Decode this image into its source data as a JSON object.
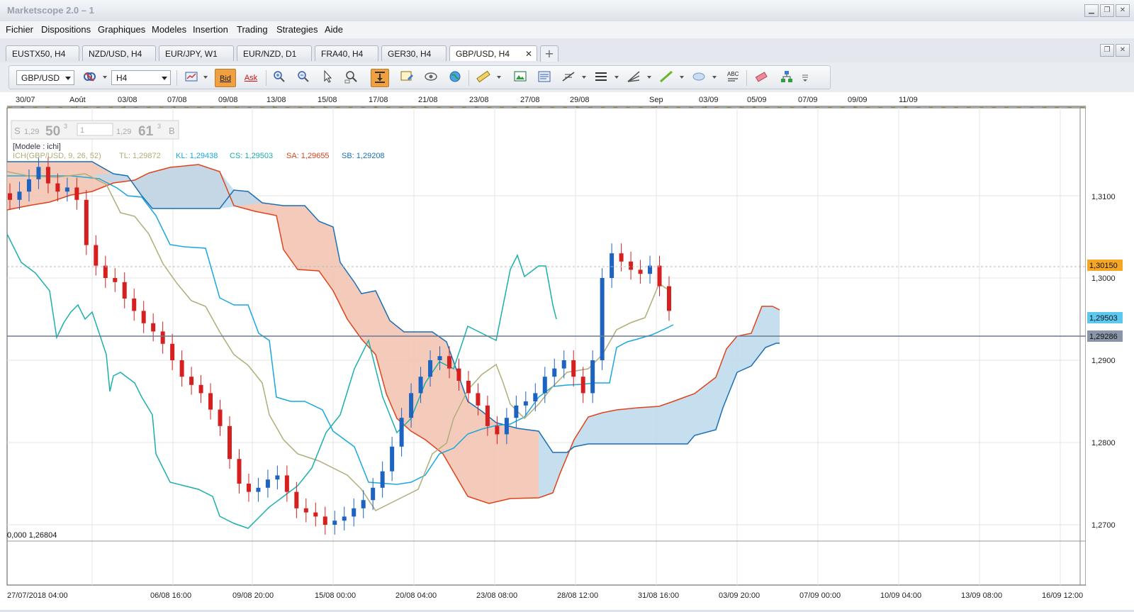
{
  "window": {
    "title": "Marketscope 2.0 – 1"
  },
  "menu": [
    "Fichier",
    "Dispositions",
    "Graphiques",
    "Modeles",
    "Insertion",
    "Trading",
    "Strategies",
    "Aide"
  ],
  "tabs": [
    {
      "label": "EUSTX50, H4"
    },
    {
      "label": "NZD/USD, H4"
    },
    {
      "label": "EUR/JPY, W1"
    },
    {
      "label": "EUR/NZD, D1"
    },
    {
      "label": "FRA40, H4"
    },
    {
      "label": "GER30, H4"
    },
    {
      "label": "GBP/USD, H4",
      "active": true
    }
  ],
  "toolbar": {
    "symbol": "GBP/USD",
    "timeframe": "H4",
    "bid_label": "Bid",
    "ask_label": "Ask",
    "icons": [
      "symbol-icon",
      "timeframe-icon",
      "chart-type-icon",
      "zoom-in-icon",
      "zoom-out-icon",
      "cursor-icon",
      "zoom-range-icon",
      "autoscroll-icon",
      "template-icon",
      "eye-icon",
      "globe-icon",
      "ruler-icon",
      "screenshot-icon",
      "properties-icon",
      "fibonacci-icon",
      "lines-icon",
      "pitchfork-icon",
      "trendline-icon",
      "ellipse-icon",
      "text-icon",
      "eraser-icon",
      "hierarchy-icon",
      "more-icon"
    ]
  },
  "dealing_box": {
    "sell_label": "S",
    "sell_prefix": "1,29",
    "sell_big": "50",
    "sell_sup": "3",
    "amount": "1",
    "buy_prefix": "1,29",
    "buy_big": "61",
    "buy_sup": "3",
    "buy_label": "B"
  },
  "chart": {
    "model_label": "[Modele : ichi]",
    "indicator_title": "ICH(GBP/USD, 9, 26, 52)",
    "legend": [
      {
        "label": "TL: 1,29872",
        "color": "#b0ad78"
      },
      {
        "label": "KL: 1,29438",
        "color": "#19a7e0"
      },
      {
        "label": "CS: 1,29503",
        "color": "#1ab0aa"
      },
      {
        "label": "SA: 1,29655",
        "color": "#e0421a"
      },
      {
        "label": "SB: 1,29208",
        "color": "#1a6fb5"
      }
    ],
    "top_axis": [
      "30/07",
      "Août",
      "03/08",
      "07/08",
      "09/08",
      "13/08",
      "15/08",
      "17/08",
      "21/08",
      "23/08",
      "27/08",
      "29/08",
      "Sep",
      "03/09",
      "05/09",
      "07/09",
      "09/09",
      "11/09"
    ],
    "bottom_axis": [
      "27/07/2018 04:00",
      "06/08 16:00",
      "09/08 20:00",
      "15/08 00:00",
      "20/08 04:00",
      "23/08 08:00",
      "28/08 12:00",
      "31/08 16:00",
      "03/09 20:00",
      "07/09 00:00",
      "10/09 04:00",
      "13/09 08:00",
      "16/09 12:00"
    ],
    "price_axis": [
      "1,3100",
      "1,3000",
      "1,2900",
      "1,2800",
      "1,2700"
    ],
    "price_tags": [
      {
        "label": "1,30150",
        "bg": "#f5a623"
      },
      {
        "label": "1,29503",
        "bg": "#5bc8f0"
      },
      {
        "label": "1,29286",
        "bg": "#8a96a8"
      }
    ],
    "fib_label": "0,000 1,26804",
    "colors": {
      "bull": "#1e63c0",
      "bear": "#d61f1f",
      "kumo_bear_fill": "#f2c2ae",
      "kumo_bull_fill": "#bcd9ec",
      "ssa": "#e0421a",
      "ssb": "#1a6fb5",
      "tenkan": "#b0ad78",
      "kijun": "#19a7e0",
      "chikou": "#1ab0aa"
    }
  },
  "chart_data": {
    "type": "candlestick",
    "symbol": "GBP/USD",
    "timeframe": "H4",
    "ylim": [
      1.265,
      1.3175
    ],
    "indicator": {
      "name": "Ichimoku",
      "params": [
        9,
        26,
        52
      ],
      "tenkan": 1.29872,
      "kijun": 1.29438,
      "chikou": 1.29503,
      "senkou_a": 1.29655,
      "senkou_b": 1.29208
    },
    "current_price": 1.29286,
    "sell": 1.29503,
    "buy": 1.29613,
    "close_series": [
      1.3095,
      1.3105,
      1.312,
      1.3135,
      1.3115,
      1.3105,
      1.311,
      1.3095,
      1.304,
      1.3015,
      1.3,
      1.2995,
      1.2975,
      1.296,
      1.2945,
      1.2935,
      1.292,
      1.29,
      1.288,
      1.287,
      1.286,
      1.284,
      1.282,
      1.278,
      1.275,
      1.274,
      1.2745,
      1.2755,
      1.276,
      1.274,
      1.272,
      1.2715,
      1.271,
      1.27,
      1.2705,
      1.271,
      1.272,
      1.273,
      1.2745,
      1.2765,
      1.2795,
      1.283,
      1.286,
      1.288,
      1.29,
      1.2905,
      1.289,
      1.2875,
      1.286,
      1.2845,
      1.282,
      1.281,
      1.283,
      1.2845,
      1.285,
      1.286,
      1.288,
      1.289,
      1.29,
      1.288,
      1.286,
      1.29,
      1.3,
      1.303,
      1.302,
      1.301,
      1.3005,
      1.3015,
      1.299,
      1.296
    ]
  }
}
